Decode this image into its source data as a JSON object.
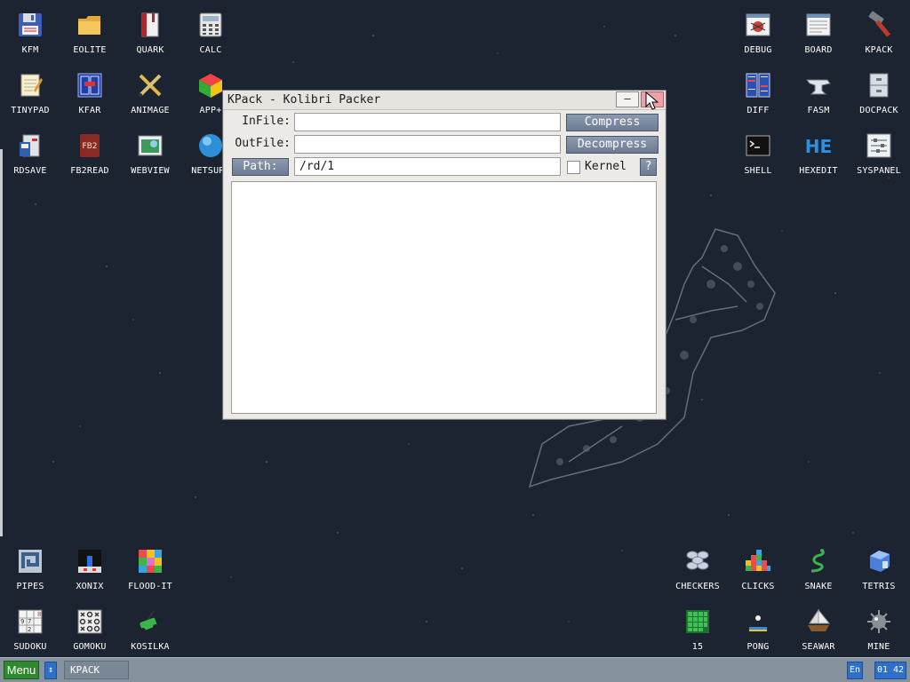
{
  "desktop": {
    "top_left_icons": [
      {
        "label": "KFM",
        "icon": "floppy-disk-icon"
      },
      {
        "label": "EOLITE",
        "icon": "folder-icon"
      },
      {
        "label": "QUARK",
        "icon": "book-icon"
      },
      {
        "label": "CALC",
        "icon": "calculator-icon"
      },
      {
        "label": "TINYPAD",
        "icon": "notepad-icon"
      },
      {
        "label": "KFAR",
        "icon": "file-manager-icon"
      },
      {
        "label": "ANIMAGE",
        "icon": "paint-tools-icon"
      },
      {
        "label": "APP+",
        "icon": "cube-icon"
      },
      {
        "label": "RDSAVE",
        "icon": "save-ramdisk-icon"
      },
      {
        "label": "FB2READ",
        "icon": "fb2-book-icon"
      },
      {
        "label": "WEBVIEW",
        "icon": "web-page-icon"
      },
      {
        "label": "NETSURF",
        "icon": "globe-icon"
      }
    ],
    "top_right_icons": [
      {
        "label": "DEBUG",
        "icon": "bug-icon"
      },
      {
        "label": "BOARD",
        "icon": "message-board-icon"
      },
      {
        "label": "KPACK",
        "icon": "hammer-icon"
      },
      {
        "label": "DIFF",
        "icon": "diff-icon"
      },
      {
        "label": "FASM",
        "icon": "anvil-icon"
      },
      {
        "label": "DOCPACK",
        "icon": "cabinet-icon"
      },
      {
        "label": "SHELL",
        "icon": "terminal-icon"
      },
      {
        "label": "HEXEDIT",
        "icon": "hex-icon"
      },
      {
        "label": "SYSPANEL",
        "icon": "sliders-icon"
      }
    ],
    "bottom_left_icons": [
      {
        "label": "PIPES",
        "icon": "pipes-icon"
      },
      {
        "label": "XONIX",
        "icon": "xonix-icon"
      },
      {
        "label": "FLOOD-IT",
        "icon": "flood-grid-icon"
      },
      {
        "label": "SUDOKU",
        "icon": "sudoku-icon"
      },
      {
        "label": "GOMOKU",
        "icon": "gomoku-icon"
      },
      {
        "label": "KOSILKA",
        "icon": "lawnmower-icon"
      }
    ],
    "bottom_right_icons": [
      {
        "label": "CHECKERS",
        "icon": "checkers-icon"
      },
      {
        "label": "CLICKS",
        "icon": "blocks-icon"
      },
      {
        "label": "SNAKE",
        "icon": "snake-icon"
      },
      {
        "label": "TETRIS",
        "icon": "tetris-icon"
      },
      {
        "label": "15",
        "icon": "puzzle15-icon"
      },
      {
        "label": "PONG",
        "icon": "pong-icon"
      },
      {
        "label": "SEAWAR",
        "icon": "ship-icon"
      },
      {
        "label": "MINE",
        "icon": "mine-icon"
      }
    ]
  },
  "window": {
    "title": "KPack - Kolibri Packer",
    "minimize_label": "–",
    "infile_label": "InFile:",
    "infile_value": "",
    "outfile_label": "OutFile:",
    "outfile_value": "",
    "path_button": "Path:",
    "path_value": "/rd/1",
    "compress_button": "Compress",
    "decompress_button": "Decompress",
    "kernel_label": "Kernel",
    "kernel_checked": false,
    "help_button": "?",
    "log_text": ""
  },
  "taskbar": {
    "menu_label": "Menu",
    "switch_glyph": "↕",
    "task_label": "KPACK",
    "language": "En",
    "clock": "01 42"
  }
}
